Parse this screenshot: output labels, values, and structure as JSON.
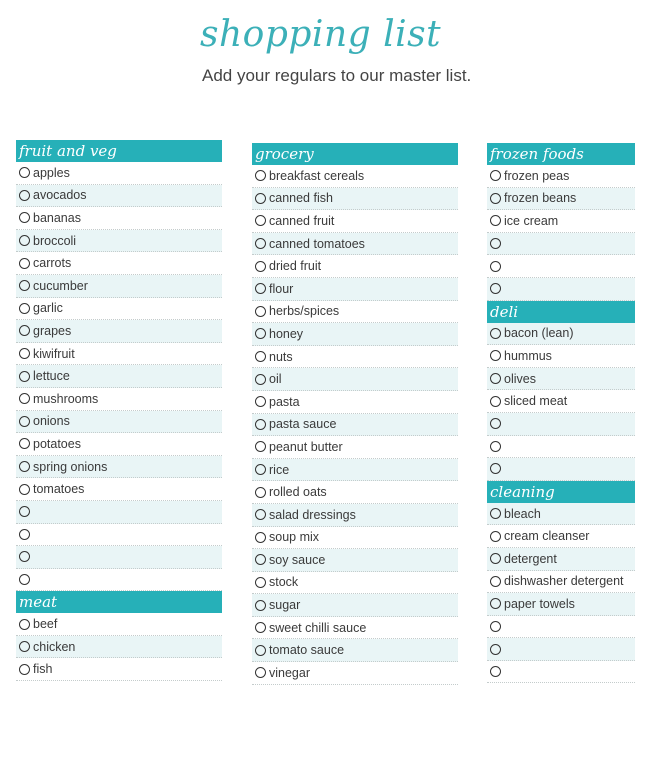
{
  "title": "shopping list",
  "subtitle": "Add your regulars to our master list.",
  "colors": {
    "header": "#26b0b8",
    "title": "#3cb0b8",
    "row_tint": "#e9f5f6"
  },
  "checkbox_icon": "empty-circle",
  "columns": [
    {
      "sections": [
        {
          "heading": "fruit and veg",
          "tint_start": 1,
          "items": [
            "apples",
            "avocados",
            "bananas",
            "broccoli",
            "carrots",
            "cucumber",
            "garlic",
            "grapes",
            "kiwifruit",
            "lettuce",
            "mushrooms",
            "onions",
            "potatoes",
            "spring onions",
            "tomatoes",
            "",
            "",
            "",
            ""
          ]
        },
        {
          "heading": "meat",
          "tint_start": 1,
          "items": [
            "beef",
            "chicken",
            "fish"
          ]
        }
      ]
    },
    {
      "sections": [
        {
          "heading": "grocery",
          "tint_start": 1,
          "items": [
            "breakfast cereals",
            "canned fish",
            "canned fruit",
            "canned tomatoes",
            "dried fruit",
            "flour",
            "herbs/spices",
            "honey",
            "nuts",
            "oil",
            "pasta",
            "pasta sauce",
            "peanut butter",
            "rice",
            "rolled oats",
            "salad dressings",
            "soup mix",
            "soy sauce",
            "stock",
            "sugar",
            "sweet chilli sauce",
            "tomato sauce",
            "vinegar"
          ]
        }
      ]
    },
    {
      "sections": [
        {
          "heading": "frozen foods",
          "tint_start": 1,
          "items": [
            "frozen peas",
            "frozen beans",
            "ice cream",
            "",
            "",
            ""
          ]
        },
        {
          "heading": "deli",
          "tint_start": 0,
          "items": [
            "bacon (lean)",
            "hummus",
            "olives",
            "sliced meat",
            "",
            "",
            ""
          ]
        },
        {
          "heading": "cleaning",
          "tint_start": 0,
          "items": [
            "bleach",
            "cream cleanser",
            "detergent",
            "dishwasher detergent",
            "paper towels",
            "",
            "",
            ""
          ]
        }
      ]
    }
  ]
}
